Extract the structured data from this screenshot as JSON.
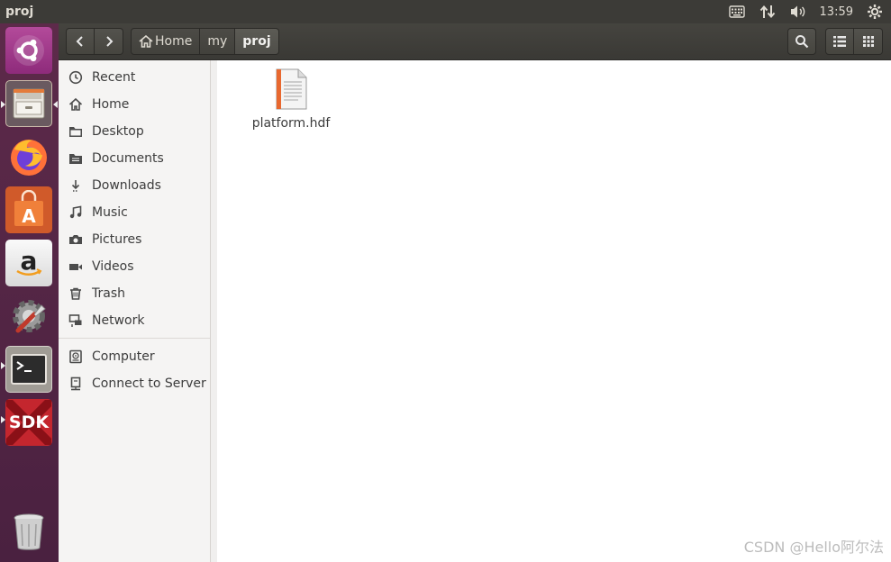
{
  "topbar": {
    "window_title": "proj",
    "clock": "13:59",
    "indicators": [
      "keyboard-icon",
      "network-arrows-icon",
      "volume-icon",
      "settings-gear-icon"
    ]
  },
  "launcher": {
    "items": [
      "ubuntu-dash",
      "files",
      "firefox",
      "software-center",
      "amazon",
      "system-settings",
      "terminal",
      "sdk",
      "trash"
    ],
    "sdk_label": "SDK"
  },
  "toolbar": {
    "breadcrumbs": [
      "Home",
      "my",
      "proj"
    ],
    "active_crumb": "proj"
  },
  "sidebar": {
    "places": [
      {
        "label": "Recent",
        "icon": "clock-icon"
      },
      {
        "label": "Home",
        "icon": "home-icon"
      },
      {
        "label": "Desktop",
        "icon": "folder-icon"
      },
      {
        "label": "Documents",
        "icon": "document-icon"
      },
      {
        "label": "Downloads",
        "icon": "download-icon"
      },
      {
        "label": "Music",
        "icon": "music-icon"
      },
      {
        "label": "Pictures",
        "icon": "camera-icon"
      },
      {
        "label": "Videos",
        "icon": "video-icon"
      },
      {
        "label": "Trash",
        "icon": "trash-icon"
      },
      {
        "label": "Network",
        "icon": "network-icon"
      }
    ],
    "devices": [
      {
        "label": "Computer",
        "icon": "computer-icon"
      },
      {
        "label": "Connect to Server",
        "icon": "server-icon"
      }
    ]
  },
  "files": [
    {
      "name": "platform.hdf"
    }
  ],
  "watermark": "CSDN @Hello阿尔法"
}
